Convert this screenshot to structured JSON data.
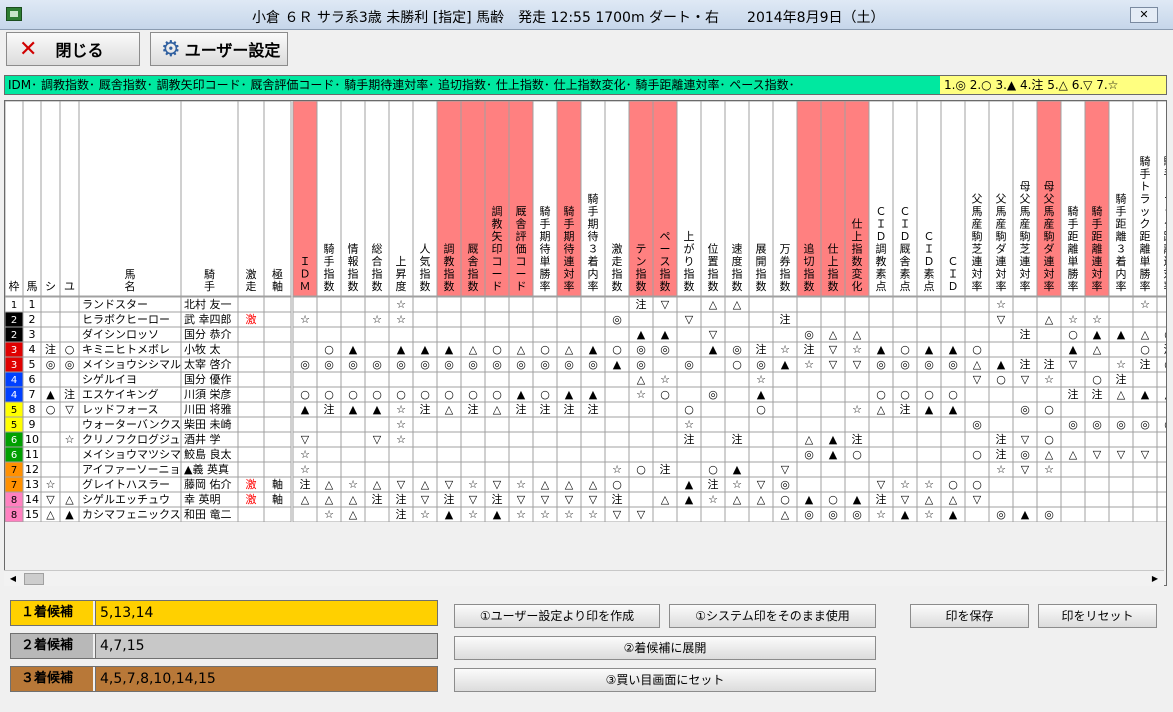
{
  "window": {
    "title": "小倉 ６Ｒ サラ系3歳 未勝利 [指定] 馬齢　発走 12:55 1700m ダート・右　　2014年8月9日（土）",
    "close_label": "✕"
  },
  "toolbar": {
    "close_label": "閉じる",
    "user_settings_label": "ユーザー設定"
  },
  "legend": {
    "index_legend": "IDM･ 調教指数･ 厩舎指数･ 調教矢印コード･ 厩舎評価コード･ 騎手期待連対率･ 追切指数･ 仕上指数･ 仕上指数変化･ 騎手距離連対率･ ペース指数･",
    "mark_legend": "1.◎ 2.○ 3.▲ 4.注 5.△ 6.▽ 7.☆"
  },
  "grid": {
    "fixed_headers": [
      "枠",
      "馬",
      "シ",
      "ユ",
      "馬名",
      "騎手",
      "激走",
      "極軸"
    ],
    "index_headers": [
      "ＩＤＭ",
      "騎手指数",
      "情報指数",
      "総合指数",
      "上昇度",
      "人気指数",
      "調教指数",
      "厩舎指数",
      "調教矢印コード",
      "厩舎評価コード",
      "騎手期待単勝率",
      "騎手期待連対率",
      "騎手期待３着内率",
      "激走指数",
      "テン指数",
      "ペース指数",
      "上がり指数",
      "位置指数",
      "速度指数",
      "展開指数",
      "万券指数",
      "追切指数",
      "仕上指数",
      "仕上指数変化",
      "ＣＩＤ調教素点",
      "ＣＩＤ厩舎素点",
      "ＣＩＤ素点",
      "ＣＩＤ",
      "父馬産駒芝連対率",
      "父馬産駒ダ連対率",
      "母父馬産駒芝連対率",
      "母父馬産駒ダ連対率",
      "騎手距離単勝率",
      "騎手距離連対率",
      "騎手距離３着内率",
      "騎手トラック距離単勝率",
      "騎手トラック距離連対率"
    ],
    "highlight_columns": [
      0,
      6,
      7,
      8,
      9,
      11,
      14,
      15,
      21,
      22,
      23,
      31,
      33
    ],
    "horses": [
      {
        "waku": "1",
        "umaban": "1",
        "shi": "",
        "yu": "",
        "name": "ランドスター",
        "jockey": "北村 友一",
        "gekiso": "",
        "kyokujiku": "",
        "marks": [
          "",
          "",
          "",
          "",
          "☆",
          "",
          "",
          "",
          "",
          "",
          "",
          "",
          "",
          "",
          "注",
          "▽",
          "",
          "△",
          "△",
          "",
          "",
          "",
          "",
          "",
          "",
          "",
          "",
          "",
          "",
          "☆",
          "",
          "",
          "",
          "",
          "",
          "☆",
          ""
        ]
      },
      {
        "waku": "2",
        "umaban": "2",
        "shi": "",
        "yu": "",
        "name": "ヒラボクヒーロー",
        "jockey": "武 幸四郎",
        "gekiso": "激",
        "kyokujiku": "",
        "marks": [
          "☆",
          "",
          "",
          "☆",
          "☆",
          "",
          "",
          "",
          "",
          "",
          "",
          "",
          "",
          "◎",
          "",
          "",
          "▽",
          "",
          "",
          "",
          "注",
          "",
          "",
          "",
          "",
          "",
          "",
          "",
          "",
          "▽",
          "",
          "△",
          "☆",
          "☆",
          "",
          "",
          ""
        ]
      },
      {
        "waku": "2",
        "umaban": "3",
        "shi": "",
        "yu": "",
        "name": "ダイシンロッソ",
        "jockey": "国分 恭介",
        "gekiso": "",
        "kyokujiku": "",
        "marks": [
          "",
          "",
          "",
          "",
          "",
          "",
          "",
          "",
          "",
          "",
          "",
          "",
          "",
          "",
          "▲",
          "▲",
          "",
          "▽",
          "",
          "",
          "",
          "◎",
          "△",
          "△",
          "",
          "",
          "",
          "",
          "",
          "",
          "注",
          "",
          "○",
          "▲",
          "▲",
          "△",
          "○"
        ]
      },
      {
        "waku": "3",
        "umaban": "4",
        "shi": "注",
        "yu": "○",
        "name": "キミニヒトメボレ",
        "jockey": "小牧 太",
        "gekiso": "",
        "kyokujiku": "",
        "marks": [
          "",
          "○",
          "▲",
          "",
          "▲",
          "▲",
          "▲",
          "△",
          "○",
          "△",
          "○",
          "△",
          "▲",
          "○",
          "◎",
          "◎",
          "",
          "▲",
          "◎",
          "注",
          "☆",
          "注",
          "▽",
          "☆",
          "▲",
          "○",
          "▲",
          "▲",
          "○",
          "",
          "",
          "",
          "▲",
          "△",
          "",
          "○",
          "注"
        ]
      },
      {
        "waku": "3",
        "umaban": "5",
        "shi": "◎",
        "yu": "◎",
        "name": "メイショウシシマル",
        "jockey": "太宰 啓介",
        "gekiso": "",
        "kyokujiku": "",
        "marks": [
          "◎",
          "◎",
          "◎",
          "◎",
          "◎",
          "◎",
          "◎",
          "◎",
          "◎",
          "◎",
          "◎",
          "◎",
          "◎",
          "▲",
          "◎",
          "",
          "◎",
          "",
          "○",
          "◎",
          "▲",
          "☆",
          "▽",
          "▽",
          "◎",
          "◎",
          "◎",
          "◎",
          "△",
          "▲",
          "注",
          "注",
          "▽",
          "",
          "☆",
          "注",
          "○"
        ]
      },
      {
        "waku": "4",
        "umaban": "6",
        "shi": "",
        "yu": "",
        "name": "シゲルイヨ",
        "jockey": "国分 優作",
        "gekiso": "",
        "kyokujiku": "",
        "marks": [
          "",
          "",
          "",
          "",
          "",
          "",
          "",
          "",
          "",
          "",
          "",
          "",
          "",
          "",
          "△",
          "☆",
          "",
          "",
          "",
          "☆",
          "",
          "",
          "",
          "",
          "",
          "",
          "",
          "",
          "▽",
          "○",
          "▽",
          "☆",
          "",
          "○",
          "注",
          "",
          ""
        ]
      },
      {
        "waku": "4",
        "umaban": "7",
        "shi": "▲",
        "yu": "注",
        "name": "エスケイキング",
        "jockey": "川須 栄彦",
        "gekiso": "",
        "kyokujiku": "",
        "marks": [
          "○",
          "○",
          "○",
          "○",
          "○",
          "○",
          "○",
          "○",
          "○",
          "▲",
          "○",
          "▲",
          "▲",
          "",
          "☆",
          "○",
          "",
          "◎",
          "",
          "▲",
          "",
          "",
          "",
          "",
          "○",
          "○",
          "○",
          "○",
          "",
          "",
          "",
          "",
          "注",
          "注",
          "△",
          "▲",
          "▲"
        ]
      },
      {
        "waku": "5",
        "umaban": "8",
        "shi": "○",
        "yu": "▽",
        "name": "レッドフォース",
        "jockey": "川田 将雅",
        "gekiso": "",
        "kyokujiku": "",
        "marks": [
          "▲",
          "注",
          "▲",
          "▲",
          "☆",
          "注",
          "△",
          "注",
          "△",
          "注",
          "注",
          "注",
          "注",
          "",
          "",
          "",
          "○",
          "",
          "",
          "○",
          "",
          "",
          "",
          "☆",
          "△",
          "注",
          "▲",
          "▲",
          "",
          "",
          "◎",
          "○",
          "",
          "",
          "",
          "",
          ""
        ]
      },
      {
        "waku": "5",
        "umaban": "9",
        "shi": "",
        "yu": "",
        "name": "ウォーターバンクス",
        "jockey": "柴田 未崎",
        "gekiso": "",
        "kyokujiku": "",
        "marks": [
          "",
          "",
          "",
          "",
          "☆",
          "",
          "",
          "",
          "",
          "",
          "",
          "",
          "",
          "",
          "",
          "",
          "☆",
          "",
          "",
          "",
          "",
          "",
          "",
          "",
          "",
          "",
          "",
          "",
          "◎",
          "",
          "",
          "",
          "◎",
          "◎",
          "◎",
          "◎",
          "○"
        ]
      },
      {
        "waku": "6",
        "umaban": "10",
        "shi": "",
        "yu": "☆",
        "name": "クリノフクログジュ",
        "jockey": "酒井 学",
        "gekiso": "",
        "kyokujiku": "",
        "marks": [
          "▽",
          "",
          "",
          "▽",
          "☆",
          "",
          "",
          "",
          "",
          "",
          "",
          "",
          "",
          "",
          "",
          "",
          "注",
          "",
          "注",
          "",
          "",
          "△",
          "▲",
          "注",
          "",
          "",
          "",
          "",
          "",
          "注",
          "▽",
          "○",
          "",
          "",
          "",
          "",
          ""
        ]
      },
      {
        "waku": "6",
        "umaban": "11",
        "shi": "",
        "yu": "",
        "name": "メイショウマツシマ",
        "jockey": "鮫島 良太",
        "gekiso": "",
        "kyokujiku": "",
        "marks": [
          "☆",
          "",
          "",
          "",
          "",
          "",
          "",
          "",
          "",
          "",
          "",
          "",
          "",
          "",
          "",
          "",
          "",
          "",
          "",
          "",
          "",
          "◎",
          "▲",
          "○",
          "",
          "",
          "",
          "",
          "○",
          "注",
          "◎",
          "△",
          "△",
          "▽",
          "▽",
          "▽",
          ""
        ]
      },
      {
        "waku": "7",
        "umaban": "12",
        "shi": "",
        "yu": "",
        "name": "アイファーソーニョ",
        "jockey": "▲義 英真",
        "gekiso": "",
        "kyokujiku": "",
        "marks": [
          "☆",
          "",
          "",
          "",
          "",
          "",
          "",
          "",
          "",
          "",
          "",
          "",
          "",
          "☆",
          "○",
          "注",
          "",
          "○",
          "▲",
          "",
          "▽",
          "",
          "",
          "",
          "",
          "",
          "",
          "",
          "",
          "☆",
          "▽",
          "☆",
          "",
          "",
          "",
          "",
          ""
        ]
      },
      {
        "waku": "7",
        "umaban": "13",
        "shi": "☆",
        "yu": "",
        "name": "グレイトハスラー",
        "jockey": "藤岡 佑介",
        "gekiso": "激",
        "kyokujiku": "軸",
        "marks": [
          "注",
          "△",
          "☆",
          "△",
          "▽",
          "△",
          "▽",
          "☆",
          "▽",
          "☆",
          "△",
          "△",
          "△",
          "○",
          "",
          "",
          "▲",
          "注",
          "☆",
          "▽",
          "◎",
          "",
          "",
          "",
          "▽",
          "☆",
          "☆",
          "○",
          "○",
          "",
          "",
          "",
          "",
          "",
          "",
          "",
          ""
        ]
      },
      {
        "waku": "8",
        "umaban": "14",
        "shi": "▽",
        "yu": "△",
        "name": "シゲルエッチュウ",
        "jockey": "幸 英明",
        "gekiso": "激",
        "kyokujiku": "軸",
        "marks": [
          "△",
          "△",
          "△",
          "注",
          "注",
          "▽",
          "注",
          "▽",
          "注",
          "▽",
          "▽",
          "▽",
          "▽",
          "注",
          "",
          "△",
          "▲",
          "☆",
          "△",
          "△",
          "○",
          "▲",
          "○",
          "▲",
          "注",
          "▽",
          "△",
          "△",
          "▽",
          "",
          "",
          "",
          "",
          "",
          "",
          "",
          ""
        ]
      },
      {
        "waku": "8",
        "umaban": "15",
        "shi": "△",
        "yu": "▲",
        "name": "カシマフェニックス",
        "jockey": "和田 竜二",
        "gekiso": "",
        "kyokujiku": "",
        "marks": [
          "",
          "☆",
          "△",
          "",
          "注",
          "☆",
          "▲",
          "☆",
          "▲",
          "☆",
          "☆",
          "☆",
          "☆",
          "▽",
          "▽",
          "",
          "",
          "",
          "",
          "",
          "△",
          "◎",
          "◎",
          "◎",
          "☆",
          "▲",
          "☆",
          "▲",
          "",
          "◎",
          "▲",
          "◎",
          "",
          "",
          "",
          "",
          ""
        ]
      }
    ]
  },
  "candidates": [
    {
      "label": "１着候補",
      "value": "5,13,14"
    },
    {
      "label": "２着候補",
      "value": "4,7,15"
    },
    {
      "label": "３着候補",
      "value": "4,5,7,8,10,14,15"
    }
  ],
  "buttons": {
    "create_from_user": "①ユーザー設定より印を作成",
    "use_system": "①システム印をそのまま使用",
    "save_marks": "印を保存",
    "reset_marks": "印をリセット",
    "expand_candidates": "②着候補に展開",
    "set_to_buy": "③買い目画面にセット"
  },
  "colors": {
    "header_highlight": "#ff8080",
    "legend_bg": "#00e8a0",
    "mark_legend_bg": "#ffff80",
    "gekiso": "#ff0000",
    "waku": [
      "#ffffff",
      "#000000",
      "#e00000",
      "#0040ff",
      "#ffff00",
      "#00a000",
      "#ff9000",
      "#ff80c0"
    ]
  }
}
